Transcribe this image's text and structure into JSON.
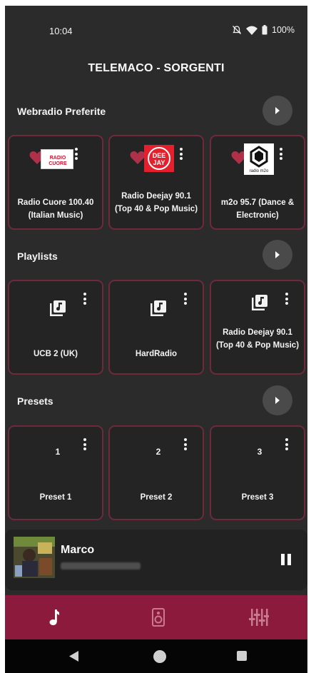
{
  "status_bar": {
    "time": "10:04",
    "battery": "100%",
    "icons": [
      "bell-off-icon",
      "wifi-icon",
      "battery-icon"
    ]
  },
  "app": {
    "title": "TELEMACO - SORGENTI"
  },
  "sections": {
    "webradio": {
      "title": "Webradio Preferite",
      "items": [
        {
          "label": "Radio Cuore 100.40 (Italian Music)",
          "logo": "radio-cuore-logo",
          "logo_text": "RADIO CUORE"
        },
        {
          "label": "Radio Deejay 90.1 (Top 40 & Pop Music)",
          "logo": "radio-deejay-logo",
          "logo_text": "DEE JAY"
        },
        {
          "label": "m2o 95.7 (Dance & Electronic)",
          "logo": "m2o-logo",
          "logo_text": "radio m2o"
        }
      ]
    },
    "playlists": {
      "title": "Playlists",
      "items": [
        {
          "label": "UCB 2 (UK)"
        },
        {
          "label": "HardRadio"
        },
        {
          "label": "Radio Deejay 90.1 (Top 40 & Pop Music)"
        }
      ]
    },
    "presets": {
      "title": "Presets",
      "items": [
        {
          "number": "1",
          "label": "Preset 1"
        },
        {
          "number": "2",
          "label": "Preset 2"
        },
        {
          "number": "3",
          "label": "Preset 3"
        }
      ]
    }
  },
  "mini_player": {
    "title": "Marco",
    "state_icon": "pause-icon"
  },
  "bottom_nav": {
    "items": [
      "music-note-icon",
      "speaker-icon",
      "equalizer-icon"
    ],
    "background": "#8c1a3c"
  },
  "colors": {
    "background": "#2b2b2b",
    "card_border": "#6e2a3b",
    "heart": "#b0304a",
    "accent": "#8c1a3c"
  }
}
